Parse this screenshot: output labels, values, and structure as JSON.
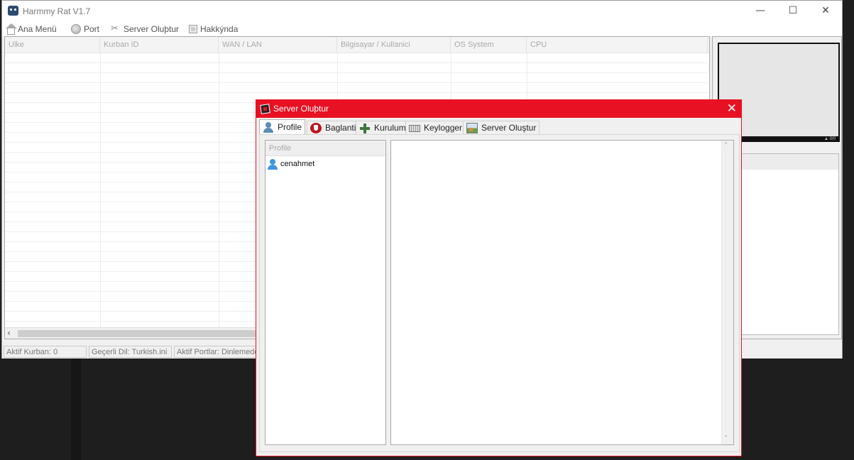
{
  "app": {
    "title": "Harmmy Rat V1.7",
    "controls": {
      "minimize": "—",
      "maximize": "☐",
      "close": "✕"
    }
  },
  "menu": [
    {
      "label": "Ana Menü",
      "icon": "home-icon"
    },
    {
      "label": "Port",
      "icon": "globe-icon"
    },
    {
      "label": "Server Oluþtur",
      "icon": "tools-icon"
    },
    {
      "label": "Hakkýnda",
      "icon": "info-icon"
    }
  ],
  "table": {
    "columns": [
      "Ulke",
      "Kurban ID",
      "WAN / LAN",
      "Bilgisayar / Kullanici",
      "OS System",
      "CPU"
    ],
    "rows": []
  },
  "right_panel": {
    "preview_tag": "▲ 0/0"
  },
  "statusbar": {
    "victims": "Aktif Kurban: 0",
    "language": "Geçerli Dil: Turkish.ini",
    "ports": "Aktif Portlar: Dinlemede Deðil"
  },
  "dialog": {
    "title": "Server Oluþtur",
    "close": "✕",
    "tabs": [
      {
        "label": "Profile",
        "icon": "user-icon",
        "active": true
      },
      {
        "label": "Baglanti",
        "icon": "plug-icon",
        "active": false
      },
      {
        "label": "Kurulum",
        "icon": "plus-icon",
        "active": false
      },
      {
        "label": "Keylogger",
        "icon": "keyboard-icon",
        "active": false
      },
      {
        "label": "Server Oluştur",
        "icon": "image-icon",
        "active": false
      }
    ],
    "profile_header": "Profile",
    "profiles": [
      "cenahmet"
    ],
    "scroll_up": "˄",
    "scroll_down": "˅"
  },
  "colors": {
    "dialog_accent": "#e81123",
    "desktop": "#1e1e1e"
  }
}
